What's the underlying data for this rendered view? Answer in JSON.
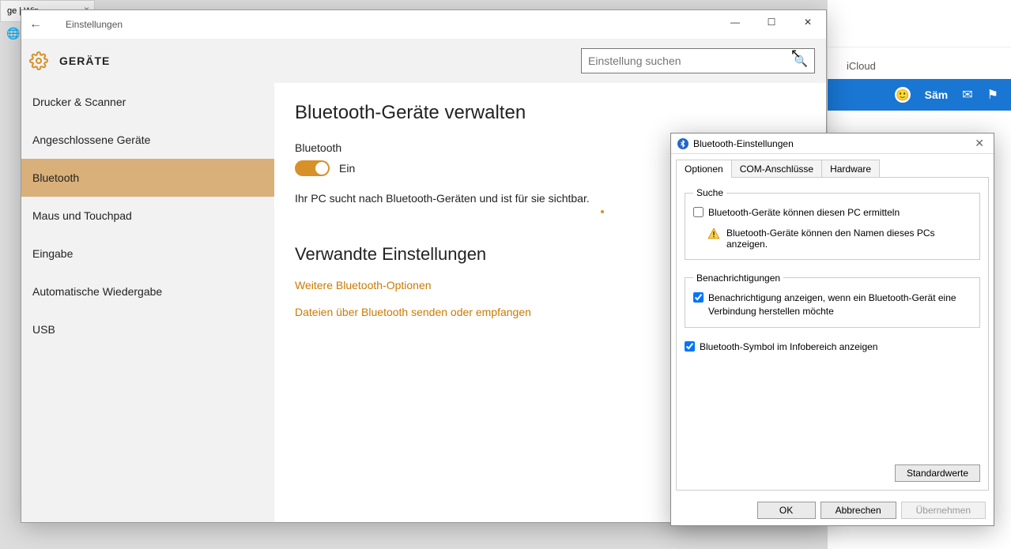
{
  "bg": {
    "tab_label": "ge | Win...",
    "icloud_label": "iCloud",
    "user_name": "Säm"
  },
  "settings": {
    "window_title": "Einstellungen",
    "header_label": "GERÄTE",
    "search_placeholder": "Einstellung suchen",
    "sidebar": {
      "items": [
        {
          "label": "Drucker & Scanner"
        },
        {
          "label": "Angeschlossene Geräte"
        },
        {
          "label": "Bluetooth"
        },
        {
          "label": "Maus und Touchpad"
        },
        {
          "label": "Eingabe"
        },
        {
          "label": "Automatische Wiedergabe"
        },
        {
          "label": "USB"
        }
      ],
      "active_index": 2
    },
    "main": {
      "heading": "Bluetooth-Geräte verwalten",
      "toggle_section_label": "Bluetooth",
      "toggle_state_label": "Ein",
      "toggle_on": true,
      "status_text": "Ihr PC sucht nach Bluetooth-Geräten und ist für sie sichtbar.",
      "related_heading": "Verwandte Einstellungen",
      "links": [
        "Weitere Bluetooth-Optionen",
        "Dateien über Bluetooth senden oder empfangen"
      ]
    }
  },
  "bt_dialog": {
    "title": "Bluetooth-Einstellungen",
    "tabs": [
      "Optionen",
      "COM-Anschlüsse",
      "Hardware"
    ],
    "active_tab": 0,
    "search_group": {
      "legend": "Suche",
      "discover_checkbox": {
        "label": "Bluetooth-Geräte können diesen PC ermitteln",
        "checked": false
      },
      "warning_text": "Bluetooth-Geräte können den Namen dieses PCs anzeigen."
    },
    "notify_group": {
      "legend": "Benachrichtigungen",
      "notify_checkbox": {
        "label": "Benachrichtigung anzeigen, wenn ein Bluetooth-Gerät eine Verbindung herstellen möchte",
        "checked": true
      }
    },
    "tray_checkbox": {
      "label": "Bluetooth-Symbol im Infobereich anzeigen",
      "checked": true
    },
    "defaults_button": "Standardwerte",
    "buttons": {
      "ok": "OK",
      "cancel": "Abbrechen",
      "apply": "Übernehmen"
    }
  }
}
